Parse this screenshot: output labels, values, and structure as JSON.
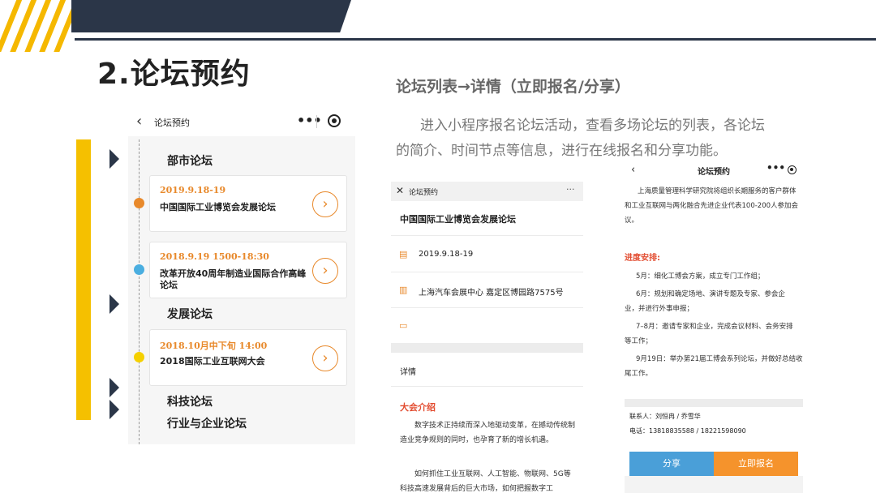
{
  "slide": {
    "title": "2.论坛预约",
    "section_heading": "论坛列表→详情（立即报名/分享）",
    "description": "进入小程序报名论坛活动，查看多场论坛的列表，各论坛的简介、时间节点等信息，进行在线报名和分享功能。"
  },
  "colors": {
    "accent_yellow": "#f5c000",
    "navy": "#2b3648",
    "orange": "#e8892b",
    "blue_button": "#4a9fd8",
    "orange_button": "#f5932c",
    "red_heading": "#e24b2f"
  },
  "screen_list": {
    "title": "论坛预约",
    "back_icon": "chevron-left-icon",
    "more_icon": "ellipsis-icon",
    "target_icon": "target-icon",
    "categories": [
      "部市论坛",
      "发展论坛",
      "科技论坛",
      "行业与企业论坛"
    ],
    "cards": [
      {
        "date": "2019.9.18-19",
        "name": "中国国际工业博览会发展论坛",
        "dot_color": "#e8892b"
      },
      {
        "date": "2018.9.19 1500-18:30",
        "name": "改革开放40周年制造业国际合作高峰论坛",
        "dot_color": "#4aaee0"
      },
      {
        "date": "2018.10月中下旬 14:00",
        "name": "2018国际工业互联网大会",
        "dot_color": "#f5d000"
      }
    ]
  },
  "screen_detail": {
    "title": "论坛预约",
    "close_icon": "close-icon",
    "more_icon": "ellipsis-icon",
    "forum_name": "中国国际工业博览会发展论坛",
    "date": "2019.9.18-19",
    "location": "上海汽车会展中心 嘉定区博园路7575号",
    "calendar_icon": "calendar-icon",
    "location_icon": "building-icon",
    "folder_icon": "folder-icon",
    "detail_label": "详情",
    "section_title": "大会介绍",
    "para1": "数字技术正持续而深入地驱动变革，在撼动传统制造业竞争规则的同时，也孕育了新的增长机遇。",
    "para2": "如何抓住工业互联网、人工智能、物联网、5G等科技高速发展背后的巨大市场，如何把握数字工"
  },
  "screen_signup": {
    "title": "论坛预约",
    "back_icon": "chevron-left-icon",
    "more_icon": "ellipsis-icon",
    "target_icon": "target-icon",
    "intro_lines": [
      "上海质量管理科学研究院将组织长期服务的客户群体",
      "和工业互联网与两化融合先进企业代表100-200人参加会",
      "议。"
    ],
    "schedule_title": "进度安排:",
    "schedule_lines": [
      "5月：细化工博会方案，成立专门工作组；",
      "6月：规划和确定场地、演讲专题及专家、参会企",
      "业，并进行外事申报；",
      "7–8月：邀请专家和企业，完成会议材料、会务安排",
      "等工作；",
      "9月19日：举办第21届工博会系列论坛，并做好总结收",
      "尾工作。"
    ],
    "contact": "联系人：刘恒冉 / 乔雪华",
    "phone": "电话：13818835588 / 18221598090",
    "share_label": "分享",
    "signup_label": "立即报名"
  }
}
